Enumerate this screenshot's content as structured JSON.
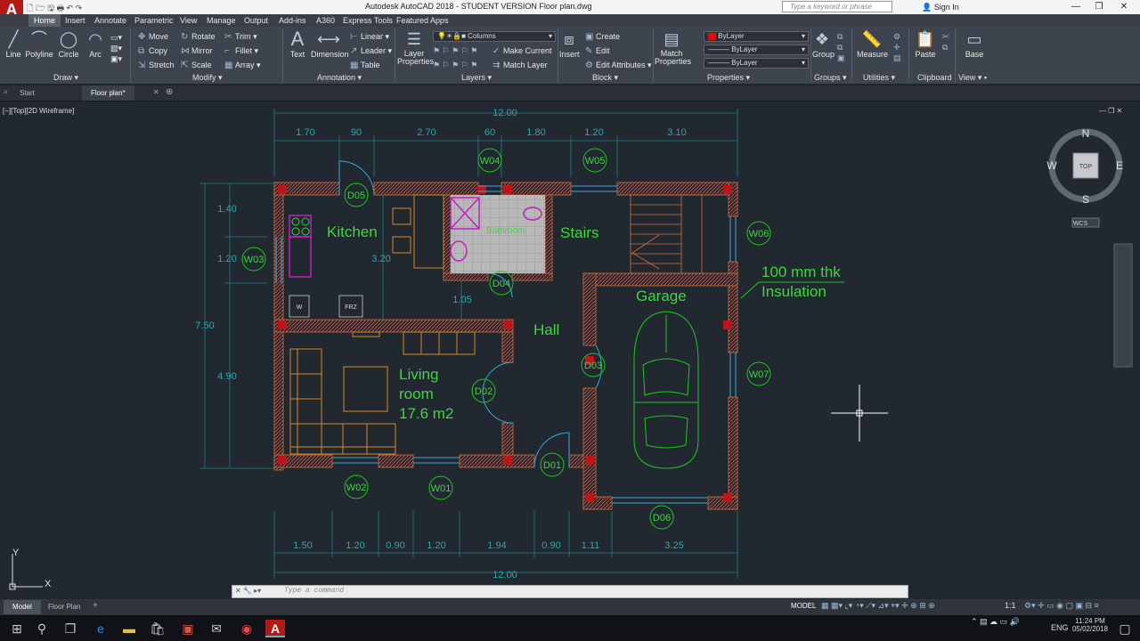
{
  "title": "Autodesk AutoCAD 2018 - STUDENT VERSION    Floor plan.dwg",
  "logo": "A",
  "search_placeholder": "Type a keyword or phrase",
  "signin": "Sign In",
  "ribbon_tabs": [
    "Home",
    "Insert",
    "Annotate",
    "Parametric",
    "View",
    "Manage",
    "Output",
    "Add-ins",
    "A360",
    "Express Tools",
    "Featured Apps"
  ],
  "draw": {
    "line": "Line",
    "polyline": "Polyline",
    "circle": "Circle",
    "arc": "Arc",
    "title": "Draw"
  },
  "modify": {
    "move": "Move",
    "rotate": "Rotate",
    "trim": "Trim",
    "copy": "Copy",
    "mirror": "Mirror",
    "fillet": "Fillet",
    "stretch": "Stretch",
    "scale": "Scale",
    "array": "Array",
    "title": "Modify"
  },
  "annotation": {
    "text": "Text",
    "dimension": "Dimension",
    "linear": "Linear",
    "leader": "Leader",
    "table": "Table",
    "title": "Annotation"
  },
  "layers": {
    "layer_props": "Layer Properties",
    "current_layer": "Columns",
    "make_current": "Make Current",
    "match_layer": "Match Layer",
    "title": "Layers"
  },
  "block": {
    "insert": "Insert",
    "create": "Create",
    "edit": "Edit",
    "edit_attr": "Edit Attributes",
    "title": "Block"
  },
  "properties": {
    "match": "Match Properties",
    "color": "ByLayer",
    "linetype": "ByLayer",
    "lineweight": "ByLayer",
    "title": "Properties"
  },
  "groups": {
    "group": "Group",
    "title": "Groups"
  },
  "utilities": {
    "measure": "Measure",
    "title": "Utilities"
  },
  "clipboard": {
    "paste": "Paste",
    "title": "Clipboard"
  },
  "view": {
    "base": "Base",
    "title": "View"
  },
  "file_tabs": [
    "Start",
    "Floor plan*"
  ],
  "viewport_controls": "[−][Top][2D Wireframe]",
  "viewcube": {
    "n": "N",
    "s": "S",
    "e": "E",
    "w": "W",
    "top": "TOP",
    "wcs": "WCS"
  },
  "dims_top": [
    "1.70",
    "90",
    "2.70",
    "60",
    "1.80",
    "1.20",
    "3.10"
  ],
  "dims_bottom": [
    "1.50",
    "1.20",
    "0.90",
    "1.20",
    "1.94",
    "0.90",
    "1.11",
    "3.25"
  ],
  "overall_width": "12.00",
  "dims_left": [
    "1.40",
    "1.20",
    "4.90",
    "7.50",
    "3.20",
    "1.05"
  ],
  "rooms": {
    "kitchen": "Kitchen",
    "stairs": "Stairs",
    "hall": "Hall",
    "garage": "Garage",
    "living1": "Living",
    "living2": "room",
    "living3": "17.6 m2",
    "bathroom": "Bathroom"
  },
  "note1": "100 mm thk",
  "note2": "Insulation",
  "frz": "FRZ",
  "wm": "W",
  "tags": [
    "D05",
    "W04",
    "W05",
    "W06",
    "W03",
    "D04",
    "D03",
    "W07",
    "D02",
    "D01",
    "W02",
    "W01",
    "D06"
  ],
  "ucs": {
    "x": "X",
    "y": "Y"
  },
  "command_placeholder": "Type a command",
  "layout_tabs": [
    "Model",
    "Floor Plan"
  ],
  "status_model": "MODEL",
  "status_scale": "1:1",
  "lang": "ENG",
  "time": "11:24 PM",
  "date": "05/02/2018"
}
